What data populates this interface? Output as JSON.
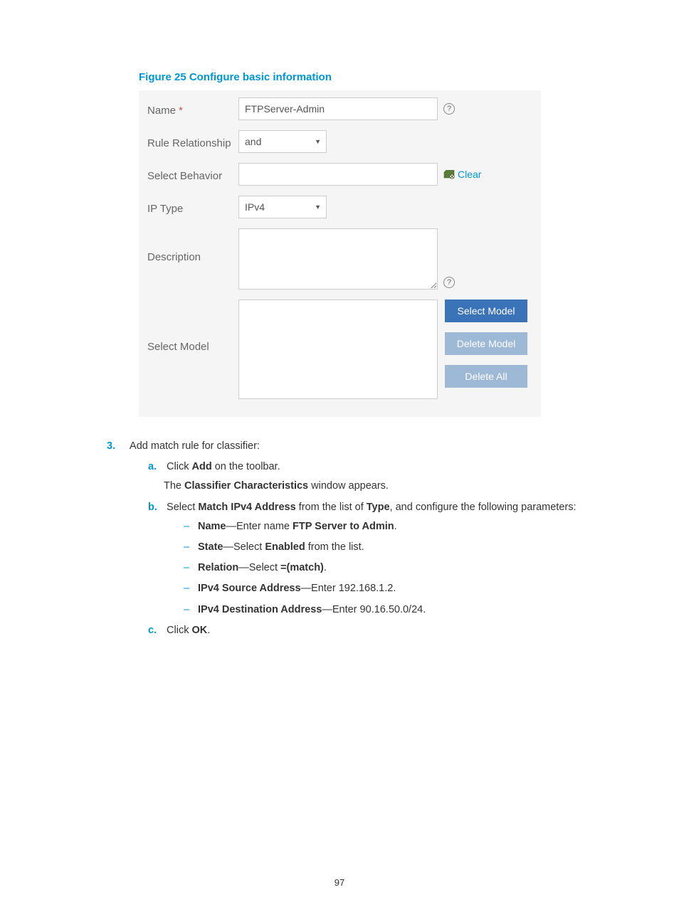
{
  "figure_title": "Figure 25 Configure basic information",
  "form": {
    "name_label": "Name",
    "name_value": "FTPServer-Admin",
    "rule_label": "Rule Relationship",
    "rule_value": "and",
    "behavior_label": "Select Behavior",
    "behavior_value": "",
    "clear_label": "Clear",
    "iptype_label": "IP Type",
    "iptype_value": "IPv4",
    "desc_label": "Description",
    "model_label": "Select Model",
    "btn_select": "Select Model",
    "btn_delete": "Delete Model",
    "btn_delete_all": "Delete All"
  },
  "step3": {
    "num": "3.",
    "text": "Add match rule for classifier:",
    "a_letter": "a.",
    "a_text1": "Click ",
    "a_bold": "Add",
    "a_text2": " on the toolbar.",
    "a_line2a": "The ",
    "a_line2b": "Classifier Characteristics",
    "a_line2c": " window appears.",
    "b_letter": "b.",
    "b_text1": "Select ",
    "b_bold1": "Match IPv4 Address",
    "b_text2": " from the list of ",
    "b_bold2": "Type",
    "b_text3": ", and configure the following parameters:",
    "dash": "–",
    "d1_b": "Name",
    "d1_t1": "—Enter name ",
    "d1_b2": "FTP Server to Admin",
    "d1_t2": ".",
    "d2_b": "State",
    "d2_t1": "—Select ",
    "d2_b2": "Enabled",
    "d2_t2": " from the list.",
    "d3_b": "Relation",
    "d3_t1": "—Select ",
    "d3_b2": "=(match)",
    "d3_t2": ".",
    "d4_b": "IPv4 Source Address",
    "d4_t": "—Enter 192.168.1.2.",
    "d5_b": "IPv4 Destination Address",
    "d5_t": "—Enter 90.16.50.0/24.",
    "c_letter": "c.",
    "c_text1": "Click ",
    "c_bold": "OK",
    "c_text2": "."
  },
  "page_number": "97"
}
